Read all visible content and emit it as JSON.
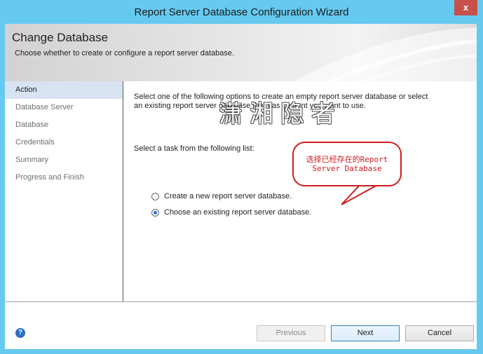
{
  "window": {
    "title": "Report Server Database Configuration Wizard",
    "close_label": "x"
  },
  "header": {
    "title": "Change Database",
    "subtitle": "Choose whether to create or configure a report server database."
  },
  "nav": {
    "items": [
      {
        "label": "Action",
        "active": true
      },
      {
        "label": "Database Server"
      },
      {
        "label": "Database"
      },
      {
        "label": "Credentials"
      },
      {
        "label": "Summary"
      },
      {
        "label": "Progress and Finish"
      }
    ]
  },
  "main": {
    "intro_line1": "Select one of the following options to create an empty report server database or select",
    "intro_line2": "an existing report server database that has content you want to use.",
    "task_label": "Select a task from the following list:",
    "options": [
      {
        "label": "Create a new report server database.",
        "checked": false
      },
      {
        "label": "Choose an existing report server database.",
        "checked": true
      }
    ]
  },
  "annotation": {
    "line1": "选择已经存在的Report",
    "line2": "Server Database",
    "color": "#d01c1c"
  },
  "watermark": {
    "text": "潇湘隐者"
  },
  "footer": {
    "help_icon": "?",
    "buttons": {
      "previous": "Previous",
      "next": "Next",
      "cancel": "Cancel"
    }
  },
  "colors": {
    "titlebar": "#66c9f0",
    "close": "#c7504a",
    "nav_active": "#d8e3f2"
  }
}
